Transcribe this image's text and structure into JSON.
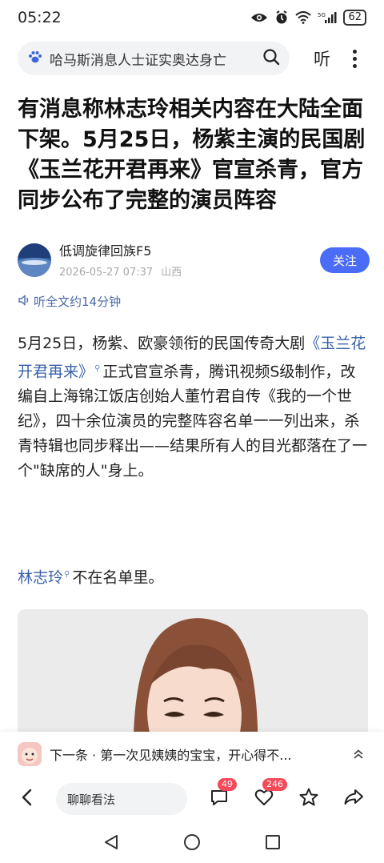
{
  "status": {
    "time": "05:22",
    "battery": "62",
    "network": "5G"
  },
  "search": {
    "text": "哈马斯消息人士证实奥达身亡",
    "listen_label": "听"
  },
  "article": {
    "title": "有消息称林志玲相关内容在大陆全面下架。5月25日，杨紫主演的民国剧《玉兰花开君再来》官宣杀青，官方同步公布了完整的演员阵容",
    "author": "低调旋律回族F5",
    "date": "2026-05-27 07:37",
    "location": "山西",
    "follow_label": "关注",
    "listen_full": "听全文约14分钟",
    "para1_a": "5月25日，杨紫、欧豪领衔的民国传奇大剧",
    "para1_link": "《玉兰花开君再来》",
    "para1_b": "正式官宣杀青，腾讯视频S级制作，改编自上海锦江饭店创始人董竹君自传《我的一个世纪》，四十余位演员的完整阵容名单一一列出来，杀青特辑也同步释出——结果所有人的目光都落在了一个\"缺席的人\"身上。",
    "para2_link": "林志玲",
    "para2_b": "不在名单里。"
  },
  "next": {
    "text": "下一条 · 第一次见姨姨的宝宝，开心得不..."
  },
  "bottom": {
    "comment_placeholder": "聊聊看法",
    "comment_count": "49",
    "like_count": "246"
  },
  "colors": {
    "accent": "#4a6cf7",
    "link": "#3a62a8",
    "badge": "#f44a5a"
  },
  "icons": [
    "wifi-icon",
    "alarm-icon",
    "eye-icon",
    "signal-icon",
    "search-icon",
    "paw-icon",
    "speaker-icon",
    "back-icon",
    "comment-icon",
    "heart-icon",
    "star-icon",
    "share-icon",
    "nav-back-icon",
    "nav-home-icon",
    "nav-recent-icon"
  ]
}
